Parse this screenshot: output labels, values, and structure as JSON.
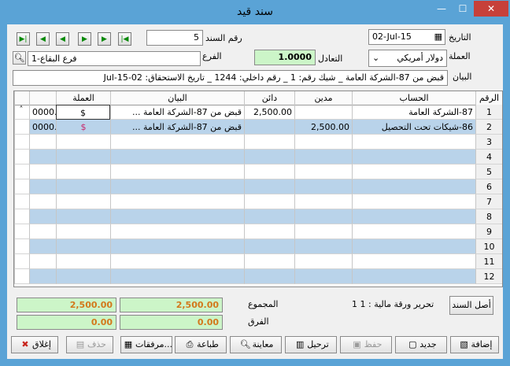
{
  "window": {
    "title": "سند قيد",
    "min_glyph": "—",
    "max_glyph": "☐",
    "close_glyph": "✕"
  },
  "nav": {
    "first": "▶|",
    "next": "▶",
    "next2": "▶",
    "prev": "◀",
    "prev2": "◀",
    "last": "|◀"
  },
  "header": {
    "voucher_no_label": "رقم السند",
    "voucher_no": "5",
    "date_label": "التاريخ",
    "date": "02-Jul-15",
    "branch_label": "الفرع",
    "branch": "1-فرع البقاع",
    "rate_label": "التعادل",
    "rate": "1.0000",
    "currency_label": "العملة",
    "currency": "دولار أمريكي",
    "description_label": "البيان",
    "description": "قبض من 87-الشركة العامة _ شيك رقم: 1 _ رقم داخلي: 1244 _ تاريخ الاستحقاق: 02-Jul-15"
  },
  "grid": {
    "columns": [
      "الرقم",
      "الحساب",
      "مدين",
      "دائن",
      "البيان",
      "العملة"
    ],
    "rows": [
      {
        "num": "1",
        "account": "87-الشركة العامة",
        "debit": "",
        "credit": "2,500.00",
        "description": "قبض من 87-الشركة العامة ...",
        "currency": "$",
        "extra": "0000."
      },
      {
        "num": "2",
        "account": "86-شيكات تحت التحصيل",
        "debit": "2,500.00",
        "credit": "",
        "description": "قبض من 87-الشركة العامة ...",
        "currency": "$",
        "extra": "0000."
      },
      {
        "num": "3"
      },
      {
        "num": "4"
      },
      {
        "num": "5"
      },
      {
        "num": "6"
      },
      {
        "num": "7"
      },
      {
        "num": "8"
      },
      {
        "num": "9"
      },
      {
        "num": "10"
      },
      {
        "num": "11"
      },
      {
        "num": "12"
      }
    ]
  },
  "totals": {
    "sum_label": "المجموع",
    "diff_label": "الفرق",
    "sum_debit": "2,500.00",
    "sum_credit": "2,500.00",
    "diff_debit": "0.00",
    "diff_credit": "0.00",
    "financial_paper": "1 تحرير ورقة مالية : 1",
    "origin_button": "أصل السند"
  },
  "buttons": {
    "close": "إغلاق",
    "delete": "حذف",
    "attachments": "مرفقات...",
    "print": "طباعة",
    "preview": "معاينة",
    "post": "ترحيل",
    "save": "حفظ",
    "new": "جديد",
    "add": "إضافة"
  },
  "colors": {
    "title_bar": "#5aa3d6",
    "selected_row": "#b9d3ea",
    "total_field": "#ccf5c8",
    "total_text": "#d3781b",
    "currency_red": "#c8266b"
  }
}
